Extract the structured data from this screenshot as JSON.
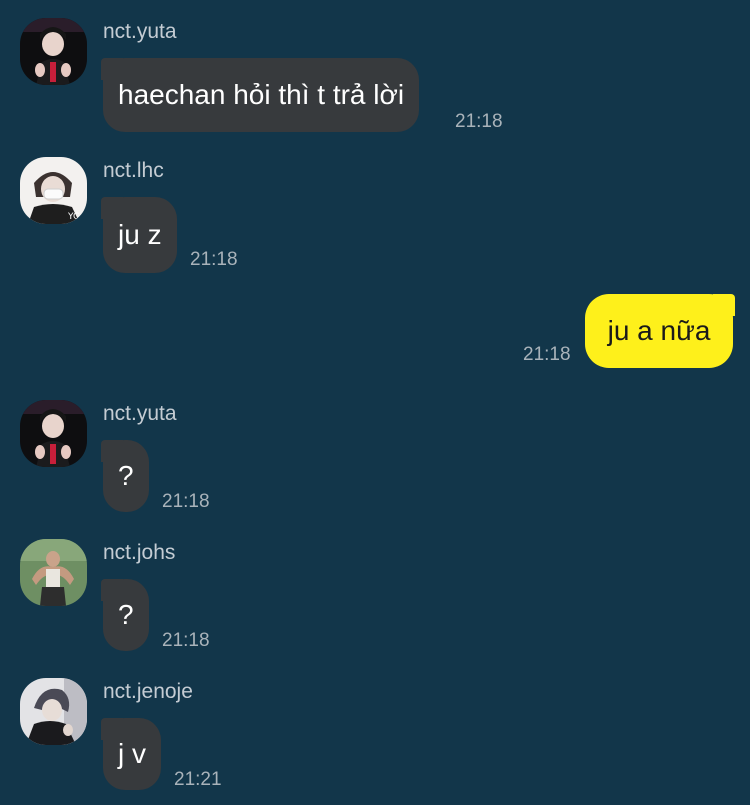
{
  "messages": [
    {
      "sender": "nct.yuta",
      "text": "haechan hỏi thì t trả lời",
      "time": "21:18",
      "avatar": "avatar-yuta"
    },
    {
      "sender": "nct.lhc",
      "text": "ju z",
      "time": "21:18",
      "avatar": "avatar-lhc"
    },
    {
      "sender": "",
      "text": "ju a nữa",
      "time": "21:18",
      "outgoing": true
    },
    {
      "sender": "nct.yuta",
      "text": "?",
      "time": "21:18",
      "avatar": "avatar-yuta"
    },
    {
      "sender": "nct.johs",
      "text": "?",
      "time": "21:18",
      "avatar": "avatar-johs"
    },
    {
      "sender": "nct.jenoje",
      "text": "j v",
      "time": "21:21",
      "avatar": "avatar-jenoje"
    }
  ],
  "colors": {
    "background": "#12364a",
    "incoming_bubble": "#373a3d",
    "outgoing_bubble": "#fef01b",
    "sender_text": "#c4ccd3",
    "time_text": "#a9b3ba"
  }
}
